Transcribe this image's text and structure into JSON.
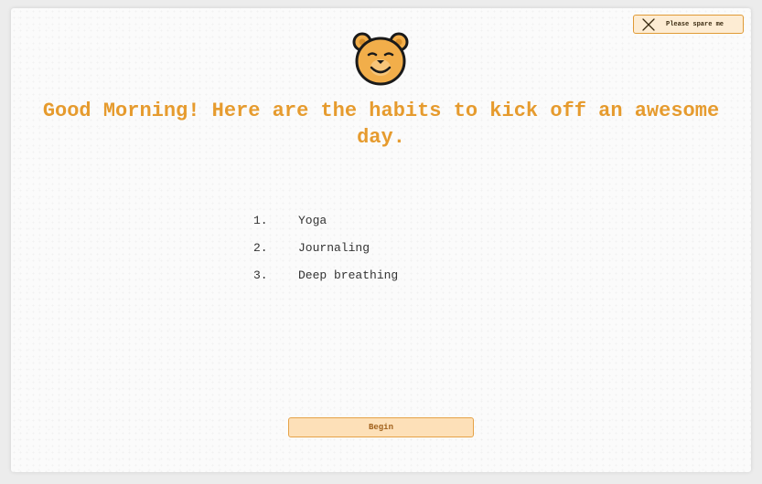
{
  "colors": {
    "accent": "#e69b2e",
    "button_fill": "#fde0b8",
    "button_border": "#e6a247",
    "bear_fill": "#f2ae4a",
    "text": "#333333"
  },
  "close_control": {
    "icon": "x-icon",
    "label": "Please spare me"
  },
  "mascot": {
    "icon": "smiling-bear-icon"
  },
  "heading": {
    "text": "Good Morning! Here are the habits to kick off an awesome day."
  },
  "habits": [
    {
      "number": "1.",
      "label": "Yoga"
    },
    {
      "number": "2.",
      "label": "Journaling"
    },
    {
      "number": "3.",
      "label": "Deep breathing"
    }
  ],
  "actions": {
    "begin_label": "Begin"
  }
}
